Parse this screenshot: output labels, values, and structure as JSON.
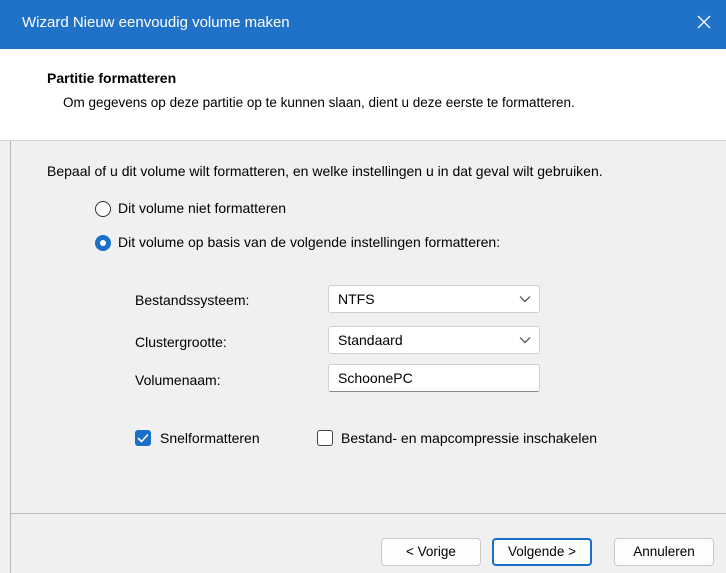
{
  "window": {
    "title": "Wizard Nieuw eenvoudig volume maken"
  },
  "header": {
    "title": "Partitie formatteren",
    "description": "Om gegevens op deze partitie op te kunnen slaan, dient u deze eerste te formatteren."
  },
  "main": {
    "prompt": "Bepaal of u dit volume wilt formatteren, en welke instellingen u in dat geval wilt gebruiken.",
    "options": [
      {
        "label": "Dit volume niet formatteren",
        "selected": false
      },
      {
        "label": "Dit volume op basis van de volgende instellingen formatteren:",
        "selected": true
      }
    ],
    "fields": {
      "filesystem": {
        "label": "Bestandssysteem:",
        "value": "NTFS"
      },
      "cluster": {
        "label": "Clustergrootte:",
        "value": "Standaard"
      },
      "volume": {
        "label": "Volumenaam:",
        "value": "SchoonePC"
      }
    },
    "checkboxes": {
      "quick": {
        "label": "Snelformatteren",
        "checked": true
      },
      "compression": {
        "label": "Bestand- en mapcompressie inschakelen",
        "checked": false
      }
    }
  },
  "buttons": {
    "back": "< Vorige",
    "next": "Volgende >",
    "cancel": "Annuleren"
  },
  "colors": {
    "titlebar": "#2072c8",
    "accent": "#1a6fc9",
    "body": "#f0f0f0"
  }
}
